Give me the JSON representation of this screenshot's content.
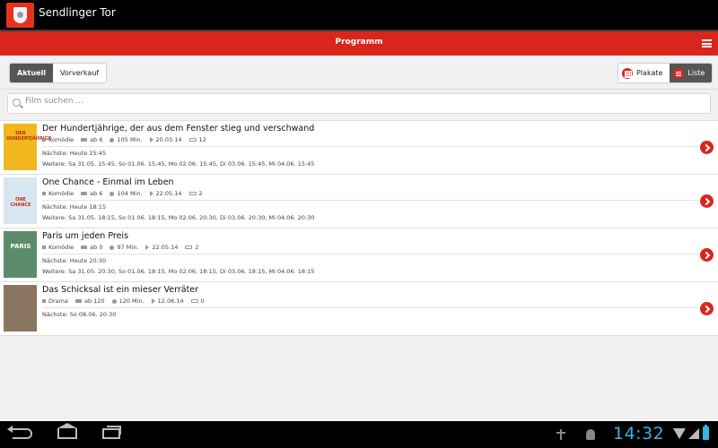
{
  "app": {
    "title": "Sendlinger Tor",
    "logo": "cinema-crest-logo"
  },
  "header": {
    "title": "Programm",
    "menu_icon": "hamburger-menu-icon"
  },
  "filter_tabs": [
    {
      "label": "Aktuell",
      "active": true
    },
    {
      "label": "Vorverkauf",
      "active": false
    }
  ],
  "view_toggle": [
    {
      "label": "Plakate",
      "icon": "grid-icon",
      "active": false
    },
    {
      "label": "Liste",
      "icon": "list-icon",
      "active": true
    }
  ],
  "search": {
    "placeholder": "Film suchen ...",
    "value": ""
  },
  "movies": [
    {
      "title": "Der Hundertjährige, der aus dem Fenster stieg und verschwand",
      "genre": "Komödie",
      "fsk": "ab 6",
      "duration": "105 Min.",
      "release": "20.03.14",
      "screens": "12",
      "next": "Nächste: Heute 15:45",
      "more": "Weitere: Sa 31.05. 15:45, So 01.06. 15:45, Mo 02.06. 15:45, Di 03.06. 15:45, Mi 04.06. 15:45",
      "poster_text": "DER HUNDERTJÄHRIGE",
      "poster_color": "#f0b81e"
    },
    {
      "title": "One Chance - Einmal im Leben",
      "genre": "Komödie",
      "fsk": "ab 6",
      "duration": "104 Min.",
      "release": "22.05.14",
      "screens": "2",
      "next": "Nächste: Heute 18:15",
      "more": "Weitere: Sa 31.05. 18:15, So 01.06. 18:15, Mo 02.06. 20:30, Di 03.06. 20:30, Mi 04.06. 20:30",
      "poster_text": "ONE CHANCE",
      "poster_color": "#d8e6ef"
    },
    {
      "title": "Paris um jeden Preis",
      "genre": "Komödie",
      "fsk": "ab 0",
      "duration": "97 Min.",
      "release": "22.05.14",
      "screens": "2",
      "next": "Nächste: Heute 20:30",
      "more": "Weitere: Sa 31.05. 20:30, So 01.06. 18:15, Mo 02.06. 18:15, Di 03.06. 18:15, Mi 04.06. 18:15",
      "poster_text": "PARIS",
      "poster_color": "#5b8c6a"
    },
    {
      "title": "Das Schicksal ist ein mieser Verräter",
      "genre": "Drama",
      "fsk": "ab 120",
      "duration": "120 Min.",
      "release": "12.06.14",
      "screens": "0",
      "next": "Nächste: So 08.06. 20:30",
      "more": "",
      "poster_text": "",
      "poster_color": "#8a7660"
    }
  ],
  "system_bar": {
    "clock": "14:32"
  },
  "colors": {
    "accent": "#d9261c",
    "status_blue": "#33b5e5"
  }
}
